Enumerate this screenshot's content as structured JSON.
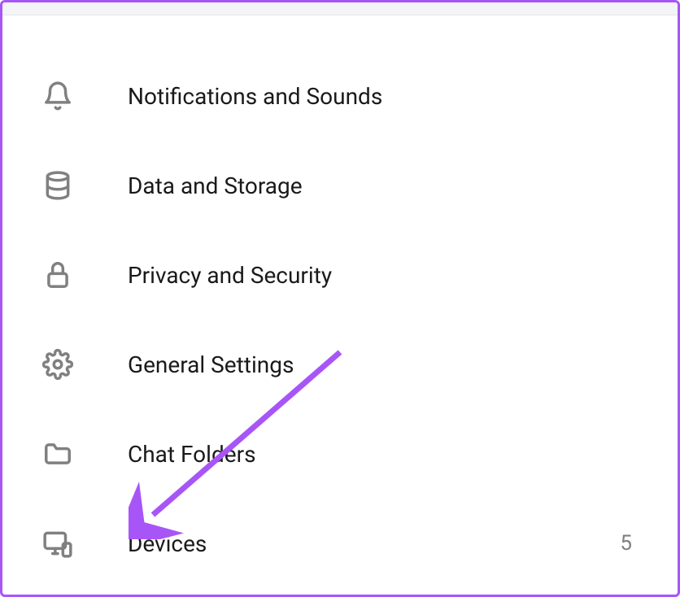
{
  "settings": {
    "items": [
      {
        "id": "notifications",
        "label": "Notifications and Sounds",
        "badge": ""
      },
      {
        "id": "data-storage",
        "label": "Data and Storage",
        "badge": ""
      },
      {
        "id": "privacy-security",
        "label": "Privacy and Security",
        "badge": ""
      },
      {
        "id": "general-settings",
        "label": "General Settings",
        "badge": ""
      },
      {
        "id": "chat-folders",
        "label": "Chat Folders",
        "badge": ""
      },
      {
        "id": "devices",
        "label": "Devices",
        "badge": "5"
      }
    ]
  }
}
